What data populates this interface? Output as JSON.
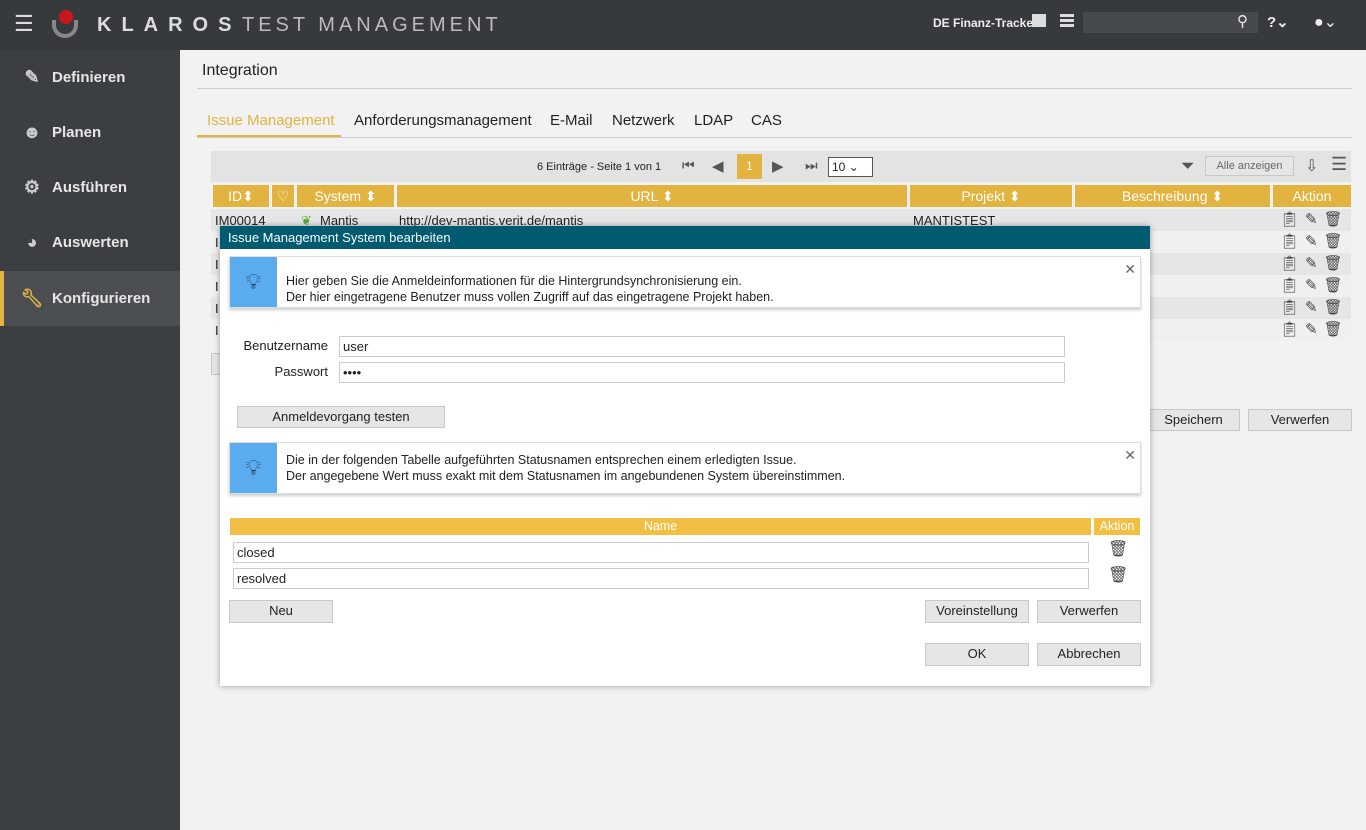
{
  "header": {
    "brand": "KLAROS",
    "product": "TEST MANAGEMENT",
    "project": "DE Finanz-Tracker",
    "search_placeholder": ""
  },
  "sidebar": {
    "items": [
      {
        "label": "Definieren",
        "icon": "edit-icon"
      },
      {
        "label": "Planen",
        "icon": "users-icon"
      },
      {
        "label": "Ausführen",
        "icon": "gear-icon"
      },
      {
        "label": "Auswerten",
        "icon": "pie-chart-icon"
      },
      {
        "label": "Konfigurieren",
        "icon": "wrench-icon",
        "active": true
      }
    ]
  },
  "page": {
    "title": "Integration",
    "tabs": [
      "Issue Management",
      "Anforderungsmanagement",
      "E-Mail",
      "Netzwerk",
      "LDAP",
      "CAS"
    ],
    "active_tab": "Issue Management"
  },
  "table": {
    "pager": "6 Einträge - Seite 1 von 1",
    "page": "1",
    "page_size": "10",
    "show_all": "Alle anzeigen",
    "columns": [
      "ID",
      "",
      "System",
      "URL",
      "Projekt",
      "Beschreibung",
      "Aktion"
    ],
    "rows": [
      {
        "id": "IM00014",
        "system": "Mantis",
        "url": "http://dev-mantis.verit.de/mantis",
        "project": "MANTISTEST"
      },
      {
        "id": "I"
      },
      {
        "id": "I"
      },
      {
        "id": "I"
      },
      {
        "id": "I"
      },
      {
        "id": "I"
      }
    ],
    "save": "Speichern",
    "discard": "Verwerfen"
  },
  "modal": {
    "title": "Issue Management System bearbeiten",
    "info1": [
      "Hier geben Sie die Anmeldeinformationen für die Hintergrundsynchronisierung ein.",
      "Der hier eingetragene Benutzer muss vollen Zugriff auf das eingetragene Projekt haben."
    ],
    "username_label": "Benutzername",
    "username": "user",
    "password_label": "Passwort",
    "password": "••••",
    "test_login": "Anmeldevorgang testen",
    "info2": [
      "Die in der folgenden Tabelle aufgeführten Statusnamen entsprechen einem erledigten Issue.",
      "Der angegebene Wert muss exakt mit dem Statusnamen im angebundenen System übereinstimmen."
    ],
    "status_columns": [
      "Name",
      "Aktion"
    ],
    "statuses": [
      "closed",
      "resolved"
    ],
    "new": "Neu",
    "defaults": "Voreinstellung",
    "discard": "Verwerfen",
    "ok": "OK",
    "cancel": "Abbrechen"
  },
  "colors": {
    "accent": "#e3b33f",
    "modal_header": "#005a70",
    "info": "#5aacef"
  }
}
